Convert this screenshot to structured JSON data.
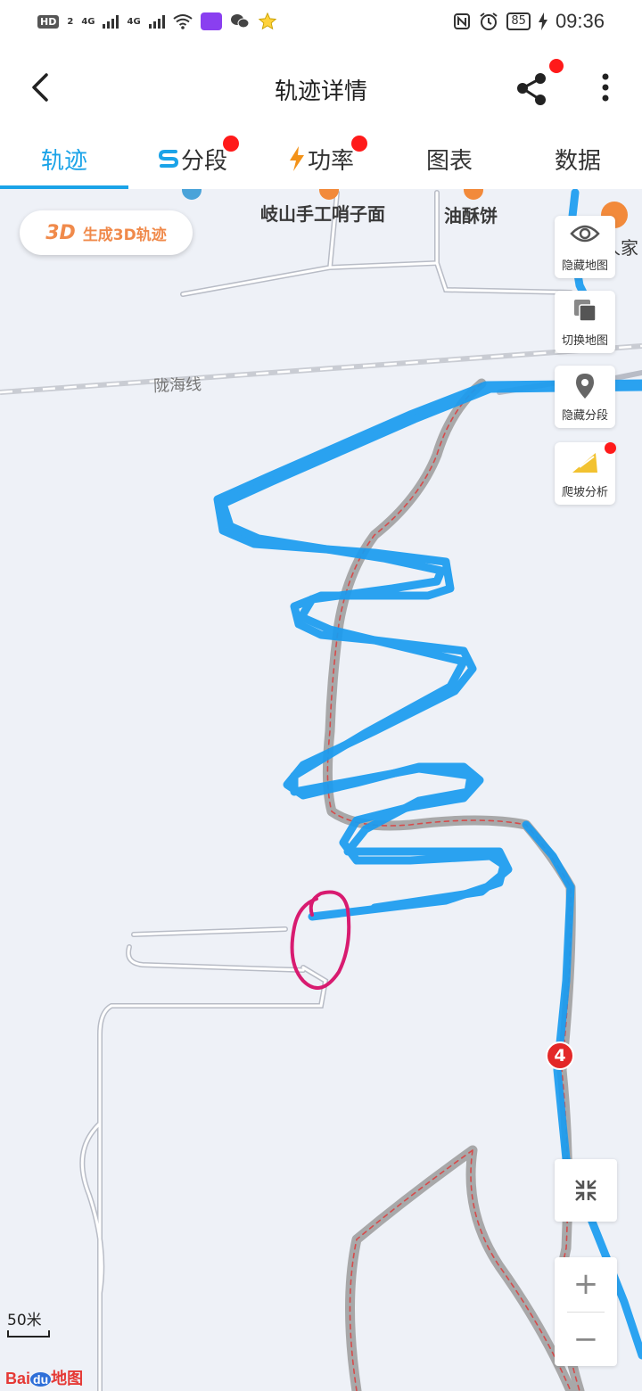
{
  "status_bar": {
    "hd_badge": "HD",
    "sim_index": "2",
    "network_1": "4G",
    "network_2": "4G",
    "battery": "85",
    "time": "09:36"
  },
  "header": {
    "title": "轨迹详情"
  },
  "tabs": [
    {
      "label": "轨迹",
      "active": true,
      "dot": false
    },
    {
      "label": "分段",
      "active": false,
      "dot": true
    },
    {
      "label": "功率",
      "active": false,
      "dot": true
    },
    {
      "label": "图表",
      "active": false,
      "dot": false
    },
    {
      "label": "数据",
      "active": false,
      "dot": false
    }
  ],
  "map": {
    "btn_3d_icon": "3D",
    "btn_3d_label": "生成3D轨迹",
    "poi_1": "岐山手工哨子面",
    "poi_2": "油酥饼",
    "poi_3": "人家",
    "rail_label": "陇海线",
    "side_buttons": [
      {
        "label": "隐藏地图",
        "icon": "eye-icon"
      },
      {
        "label": "切换地图",
        "icon": "layers-icon"
      },
      {
        "label": "隐藏分段",
        "icon": "location-pin-icon"
      },
      {
        "label": "爬坡分析",
        "icon": "slope-icon"
      }
    ],
    "km_marker": "4",
    "scale_label": "50米",
    "logo_text_1": "Bai",
    "logo_text_2": "du",
    "logo_text_3": "地图",
    "zoom_in": "+",
    "zoom_out": "−",
    "colors": {
      "track": "#1a9cf0",
      "annotation": "#d81b70",
      "accent": "#1aa3e8"
    }
  }
}
